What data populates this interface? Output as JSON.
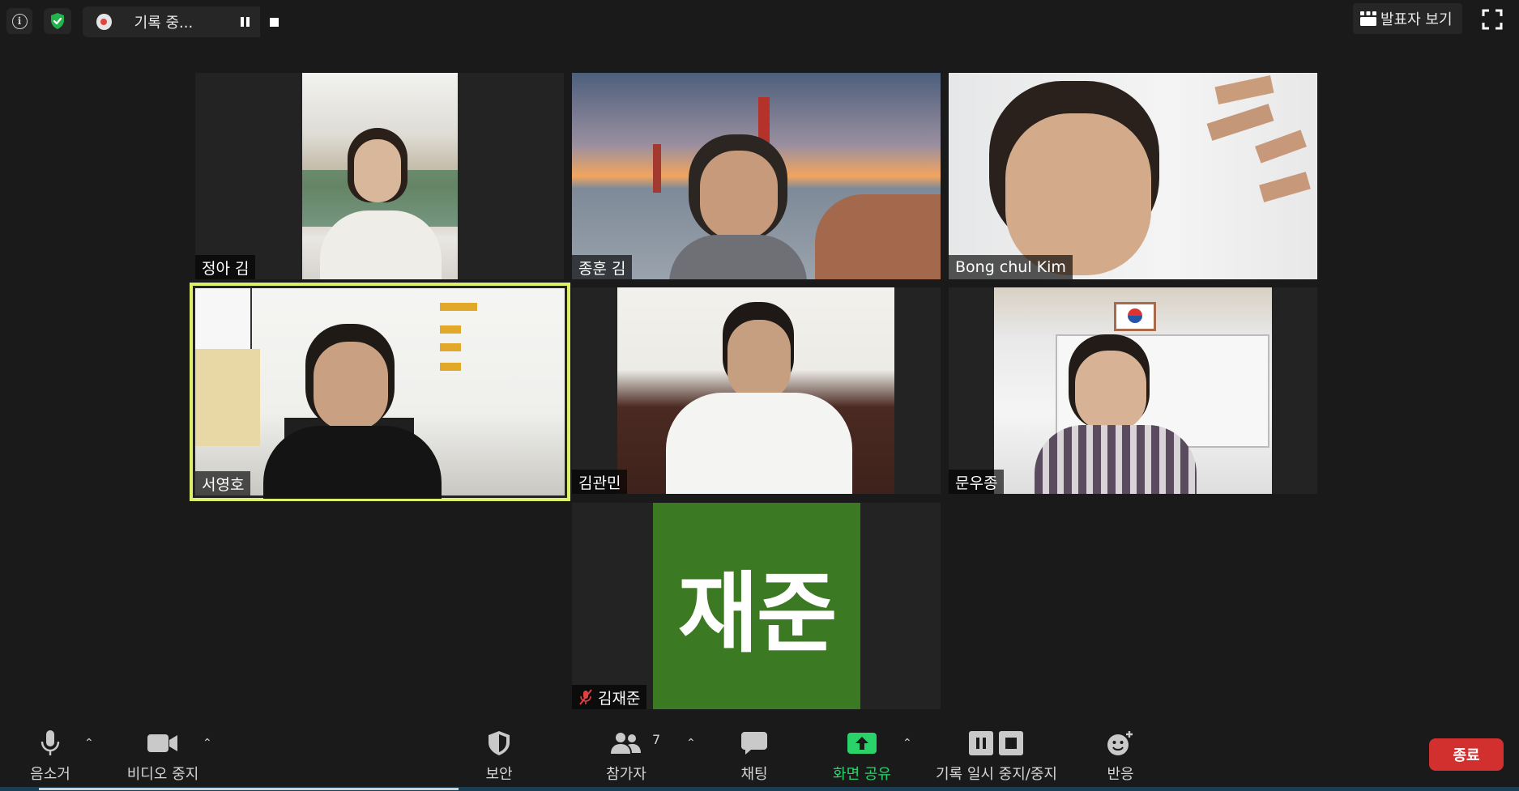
{
  "top_bar": {
    "info_icon": "info-icon",
    "security_icon": "shield-check-icon",
    "recording": {
      "status_text": "기록 중...",
      "pause_icon": "pause-icon",
      "stop_icon": "stop-icon"
    },
    "speaker_view_label": "발표자 보기",
    "fullscreen_icon": "fullscreen-icon"
  },
  "participants": [
    {
      "name": "정아 김"
    },
    {
      "name": "종훈 김"
    },
    {
      "name": "Bong chul Kim"
    },
    {
      "name": "서영호",
      "active_speaker": true
    },
    {
      "name": "김관민"
    },
    {
      "name": "문우종"
    },
    {
      "name": "김재준",
      "avatar_text": "재준",
      "muted": true
    }
  ],
  "toolbar": {
    "mute": {
      "label": "음소거",
      "icon": "microphone-icon"
    },
    "video": {
      "label": "비디오 중지",
      "icon": "video-camera-icon"
    },
    "security": {
      "label": "보안",
      "icon": "shield-icon"
    },
    "participants": {
      "label": "참가자",
      "count": "7",
      "icon": "participants-icon"
    },
    "chat": {
      "label": "채팅",
      "icon": "chat-bubble-icon"
    },
    "share": {
      "label": "화면 공유",
      "icon": "share-screen-icon"
    },
    "record": {
      "label": "기록 일시 중지/중지",
      "icon": "record-pause-stop-icon"
    },
    "reactions": {
      "label": "반응",
      "icon": "reaction-emoji-icon"
    },
    "end_label": "종료"
  },
  "colors": {
    "background": "#1a1a1a",
    "active_speaker_border": "#dcee6a",
    "end_button": "#d22f2f",
    "share_green": "#2ad36a",
    "avatar_green": "#3b7a23"
  }
}
